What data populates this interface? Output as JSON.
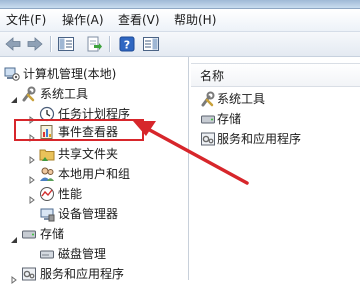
{
  "menubar": {
    "file": "文件(F)",
    "action": "操作(A)",
    "view": "查看(V)",
    "help": "帮助(H)"
  },
  "tree": {
    "root": "计算机管理(本地)",
    "system_tools": "系统工具",
    "task_scheduler": "任务计划程序",
    "event_viewer": "事件查看器",
    "shared_folders": "共享文件夹",
    "local_users": "本地用户和组",
    "performance": "性能",
    "device_manager": "设备管理器",
    "storage": "存储",
    "disk_management": "磁盘管理",
    "services": "服务和应用程序"
  },
  "list": {
    "header": "名称",
    "items": [
      "系统工具",
      "存储",
      "服务和应用程序"
    ]
  },
  "colors": {
    "highlight": "#d7262b"
  },
  "icons": [
    "back-arrow-icon",
    "forward-arrow-icon",
    "show-hide-tree-icon",
    "export-list-icon",
    "help-icon",
    "action-pane-icon",
    "computer-management-icon",
    "tools-icon",
    "clock-icon",
    "event-log-icon",
    "shared-folder-icon",
    "users-icon",
    "performance-icon",
    "device-manager-icon",
    "storage-icon",
    "disk-icon",
    "services-icon"
  ]
}
